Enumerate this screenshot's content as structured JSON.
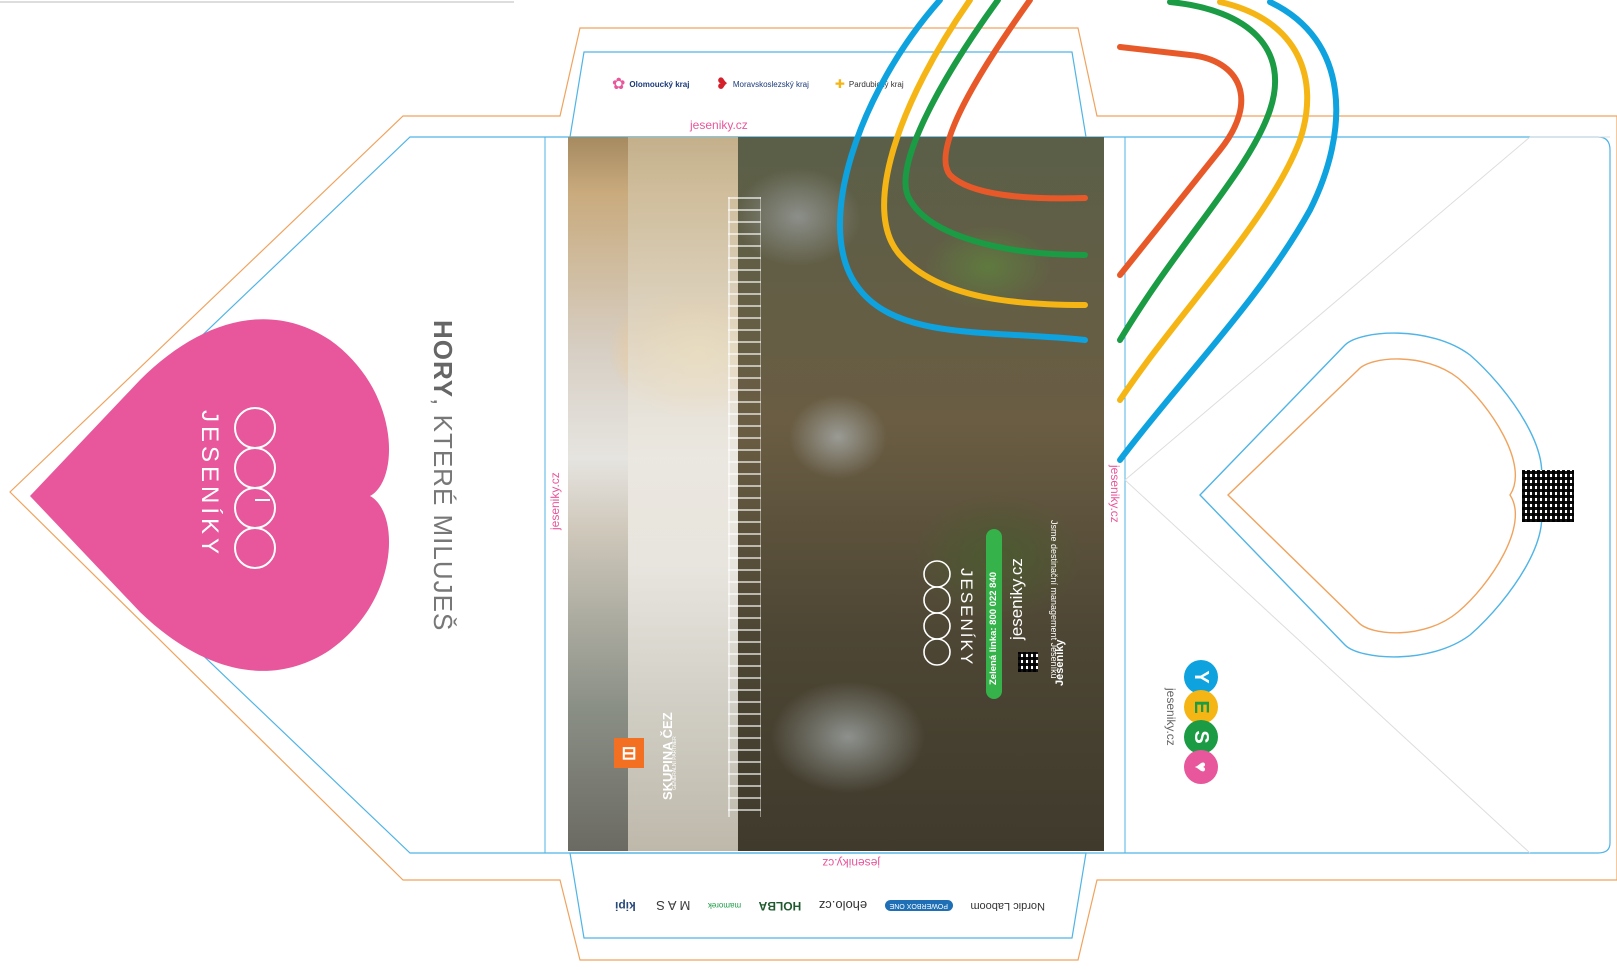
{
  "left_panel": {
    "heart_logo_text": "JESENÍKY",
    "tagline_bold": "HORY",
    "tagline_rest": ", KTERÉ MILUJEŠ"
  },
  "top_flap": {
    "logos": [
      "Olomoucký kraj",
      "Moravskoslezský kraj",
      "Pardubický kraj"
    ],
    "url": "jeseniky.cz"
  },
  "cover": {
    "side_url_left": "jeseniky.cz",
    "side_url_right": "jeseniky.cz",
    "bottom_url": "jeseniky.cz",
    "sponsor_name": "SKUPINA ČEZ",
    "sponsor_sub": "GENERÁLNÍ PARTNER",
    "brand": "JESENÍKY",
    "hotline": "Zelená linka: 800 022 840",
    "website": "jeseniky.cz",
    "management": "Jsme destinační management Jeseníků",
    "small_logo": "Jeseníky"
  },
  "bottom_flap": {
    "logos": [
      "kipi",
      "MAS",
      "mamorek",
      "HOLBA",
      "eholo.cz",
      "POWERBOX ONE",
      "Nordic Laboom"
    ]
  },
  "right_panel": {
    "yes_letters": [
      "Y",
      "E",
      "S"
    ],
    "yes_url": "jeseniky.cz"
  },
  "colors": {
    "pink": "#e8579b",
    "blue": "#0ea2df",
    "orange": "#e8592a",
    "yellow": "#f5b514",
    "green": "#1a9b44",
    "dieline_orange": "#f0a35e",
    "dieline_blue": "#4fb4e6",
    "cez_orange": "#f36f21",
    "hotline_green": "#35b34a"
  }
}
